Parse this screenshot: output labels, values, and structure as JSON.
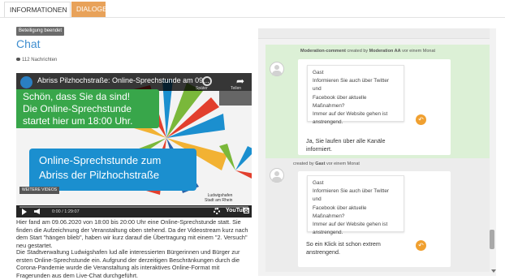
{
  "tabs": [
    {
      "label": "INFORMATIONEN"
    },
    {
      "label": "DIALOGE"
    }
  ],
  "left": {
    "badge": "Beteiligung beendet",
    "title": "Chat",
    "message_count": "112 Nachrichten",
    "video": {
      "title": "Abriss Pilzhochstraße: Online-Sprechstunde am 09...",
      "later_label": "Später",
      "share_label": "Teilen",
      "green_lines": [
        "Schön, dass Sie da sind!",
        "Die Online-Sprechstunde",
        "startet hier um 18:00 Uhr."
      ],
      "blue_lines": [
        "Online-Sprechstunde zum",
        "Abriss der Pilzhochstraße"
      ],
      "more_videos": "WEITERE VIDEOS",
      "time": "0:00 / 1:29:07",
      "city_label": "Ludwigshafen",
      "city_sub": "Stadt am Rhein",
      "youtube_label": "YouTube"
    },
    "paragraph1": "Hier fand am 09.06.2020 von 18:00 bis 20:00 Uhr eine Online-Sprechstunde statt. Sie finden die Aufzeichnung der Veranstaltung oben stehend. Da der Videostream kurz nach dem Start \"hängen blieb\", haben wir kurz darauf die Übertragung mit einem \"2. Versuch\" neu gestartet.",
    "paragraph2": "Die Stadtverwaltung Ludwigshafen lud alle interessierten Bürgerinnen und Bürger zur ersten Online-Sprechstunde ein. Aufgrund der derzeitigen Beschränkungen durch die Corona-Pandemie wurde die Veranstaltung als interaktives Online-Format mit Fragerunden aus dem Live-Chat durchgeführt."
  },
  "chat": {
    "comments": [
      {
        "meta_prefix": "Moderation-comment",
        "meta_created": "created by",
        "author": "Moderation AA",
        "time": "vor einem Monat",
        "quote_name": "Gast",
        "quote_lines": [
          "Informieren Sie auch über Twitter und",
          "Facebook über aktuelle Maßnahmen?",
          "Immer auf der Website gehen ist",
          "anstrengend."
        ],
        "response_lines": [
          "Ja, Sie laufen über alle Kanäle",
          "informiert."
        ],
        "reply_icon": "reply-icon"
      },
      {
        "meta_prefix": "",
        "meta_created": "created by",
        "author": "Gast",
        "time": "vor einem Monat",
        "quote_name": "Gast",
        "quote_lines": [
          "Informieren Sie auch über Twitter und",
          "Facebook über aktuelle Maßnahmen?",
          "Immer auf der Website gehen ist",
          "anstrengend."
        ],
        "response_lines": [
          "So ein Klick ist schon extrem",
          "anstrengend."
        ],
        "reply_icon": "reply-icon"
      }
    ]
  },
  "colors": {
    "tab_active": "#e8a25a",
    "title_blue": "#3f8ecf",
    "green_video": "#38a64a",
    "blue_video": "#1b8fcf",
    "moderation_bg": "#dcf0d6",
    "reply_orange": "#f0a030"
  }
}
